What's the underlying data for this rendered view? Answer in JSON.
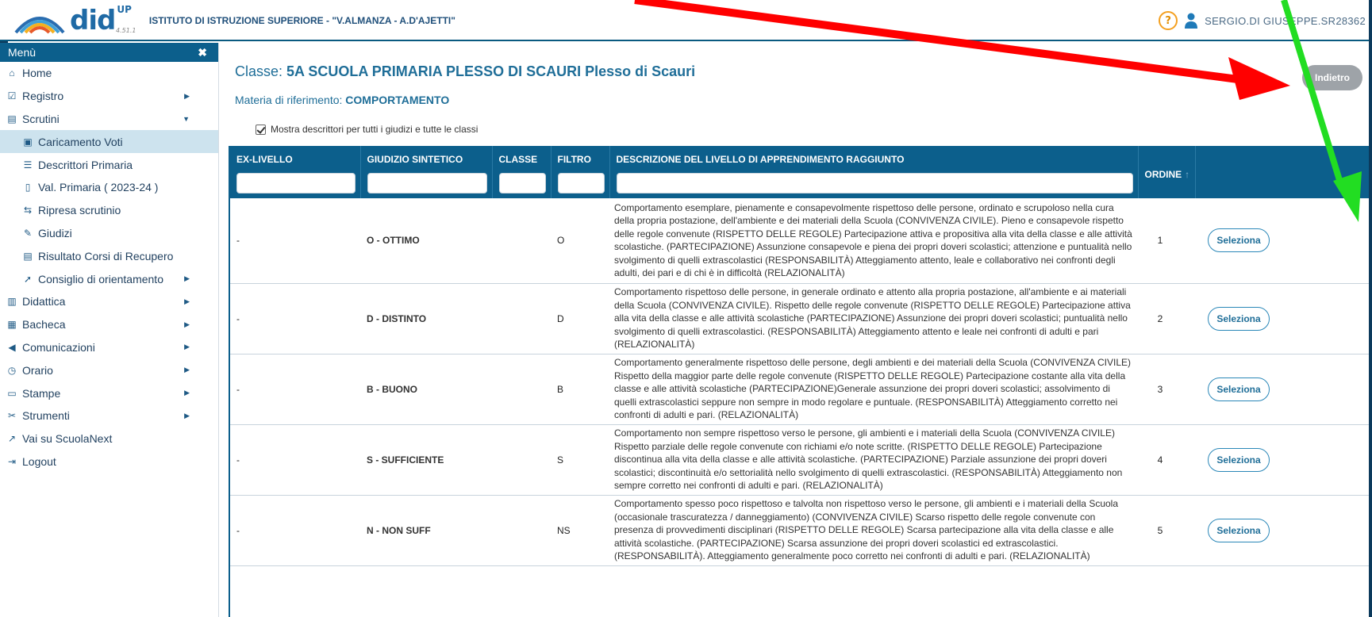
{
  "header": {
    "logo_text": "did",
    "logo_up": "UP",
    "version": "4.51.1",
    "school": "ISTITUTO DI ISTRUZIONE SUPERIORE - \"V.ALMANZA - A.D'AJETTI\"",
    "help_label": "?",
    "user": "SERGIO.DI GIUSEPPE.SR28362"
  },
  "sidebar": {
    "title": "Menù",
    "close_label": "✖",
    "items": [
      {
        "label": "Home",
        "icon": "home-icon"
      },
      {
        "label": "Registro",
        "icon": "calendar-check-icon"
      },
      {
        "label": "Scrutini",
        "icon": "doc-icon"
      },
      {
        "label": "Caricamento Voti",
        "icon": "list-doc-icon"
      },
      {
        "label": "Descrittori Primaria",
        "icon": "lines-icon"
      },
      {
        "label": "Val. Primaria ( 2023-24 )",
        "icon": "clipboard-icon"
      },
      {
        "label": "Ripresa scrutinio",
        "icon": "retweet-icon"
      },
      {
        "label": "Giudizi",
        "icon": "edit-icon"
      },
      {
        "label": "Risultato Corsi di Recupero",
        "icon": "doc-icon"
      },
      {
        "label": "Consiglio di orientamento",
        "icon": "compass-icon"
      },
      {
        "label": "Didattica",
        "icon": "book-icon"
      },
      {
        "label": "Bacheca",
        "icon": "board-icon"
      },
      {
        "label": "Comunicazioni",
        "icon": "megaphone-icon"
      },
      {
        "label": "Orario",
        "icon": "clock-icon"
      },
      {
        "label": "Stampe",
        "icon": "print-icon"
      },
      {
        "label": "Strumenti",
        "icon": "tools-icon"
      },
      {
        "label": "Vai su ScuolaNext",
        "icon": "external-link-icon"
      },
      {
        "label": "Logout",
        "icon": "logout-icon"
      }
    ]
  },
  "main": {
    "class_label": "Classe:",
    "class_value": "5A SCUOLA PRIMARIA PLESSO DI SCAURI Plesso di Scauri",
    "subject_label": "Materia di riferimento:",
    "subject_value": "COMPORTAMENTO",
    "back_label": "Indietro",
    "show_all_label": "Mostra descrittori per tutti i giudizi e tutte le classi"
  },
  "table": {
    "columns": [
      "EX-LIVELLO",
      "GIUDIZIO SINTETICO",
      "CLASSE",
      "FILTRO",
      "DESCRIZIONE DEL LIVELLO DI APPRENDIMENTO RAGGIUNTO",
      "ORDINE"
    ],
    "sort_indicator": "↑",
    "select_label": "Seleziona",
    "rows": [
      {
        "ex": "-",
        "giudizio": "O - OTTIMO",
        "classe": "",
        "filtro": "O",
        "ordine": "1",
        "descrizione": "Comportamento esemplare, pienamente e consapevolmente rispettoso delle persone, ordinato e scrupoloso nella cura della propria postazione, dell'ambiente e dei materiali della Scuola (CONVIVENZA CIVILE). Pieno e consapevole rispetto delle regole convenute (RISPETTO DELLE REGOLE) Partecipazione attiva e propositiva alla vita della classe e alle attività scolastiche. (PARTECIPAZIONE) Assunzione consapevole e piena dei propri doveri scolastici; attenzione e puntualità nello svolgimento di quelli extrascolastici (RESPONSABILITÀ) Atteggiamento attento, leale e collaborativo nei confronti degli adulti, dei pari e di chi è in difficoltà (RELAZIONALITÀ)"
      },
      {
        "ex": "-",
        "giudizio": "D - DISTINTO",
        "classe": "",
        "filtro": "D",
        "ordine": "2",
        "descrizione": "Comportamento rispettoso delle persone, in generale ordinato e attento alla propria postazione, all'ambiente e ai materiali della Scuola (CONVIVENZA CIVILE). Rispetto delle regole convenute (RISPETTO DELLE REGOLE) Partecipazione attiva alla vita della classe e alle attività scolastiche (PARTECIPAZIONE) Assunzione dei propri doveri scolastici; puntualità nello svolgimento di quelli extrascolastici. (RESPONSABILITÀ) Atteggiamento attento e leale nei confronti di adulti e pari (RELAZIONALITÀ)"
      },
      {
        "ex": "-",
        "giudizio": "B - BUONO",
        "classe": "",
        "filtro": "B",
        "ordine": "3",
        "descrizione": "Comportamento generalmente rispettoso delle persone, degli ambienti e dei materiali della Scuola (CONVIVENZA CIVILE) Rispetto della maggior parte delle regole convenute (RISPETTO DELLE REGOLE) Partecipazione costante alla vita della classe e alle attività scolastiche (PARTECIPAZIONE)Generale assunzione dei propri doveri scolastici; assolvimento di quelli extrascolastici seppure non sempre in modo regolare e puntuale. (RESPONSABILITÀ) Atteggiamento corretto nei confronti di adulti e pari. (RELAZIONALITÀ)"
      },
      {
        "ex": "-",
        "giudizio": "S - SUFFICIENTE",
        "classe": "",
        "filtro": "S",
        "ordine": "4",
        "descrizione": "Comportamento non sempre rispettoso verso le persone, gli ambienti e i materiali della Scuola (CONVIVENZA CIVILE) Rispetto parziale delle regole convenute con richiami e/o note scritte. (RISPETTO DELLE REGOLE) Partecipazione discontinua alla vita della classe e alle attività scolastiche. (PARTECIPAZIONE) Parziale assunzione dei propri doveri scolastici; discontinuità e/o settorialità nello svolgimento di quelli extrascolastici. (RESPONSABILITÀ) Atteggiamento non sempre corretto nei confronti di adulti e pari. (RELAZIONALITÀ)"
      },
      {
        "ex": "-",
        "giudizio": "N - NON SUFF",
        "classe": "",
        "filtro": "NS",
        "ordine": "5",
        "descrizione": "Comportamento spesso poco rispettoso e talvolta non rispettoso verso le persone, gli ambienti e i materiali della Scuola (occasionale trascuratezza / danneggiamento) (CONVIVENZA CIVILE) Scarso rispetto delle regole convenute con presenza di provvedimenti disciplinari (RISPETTO DELLE REGOLE) Scarsa partecipazione alla vita della classe e alle attività scolastiche. (PARTECIPAZIONE) Scarsa assunzione dei propri doveri scolastici ed extrascolastici. (RESPONSABILITÀ). Atteggiamento generalmente poco corretto nei confronti di adulti e pari. (RELAZIONALITÀ)"
      }
    ]
  },
  "annotations": {
    "red_arrow_color": "#ff0000",
    "green_arrow_color": "#22dd22"
  }
}
